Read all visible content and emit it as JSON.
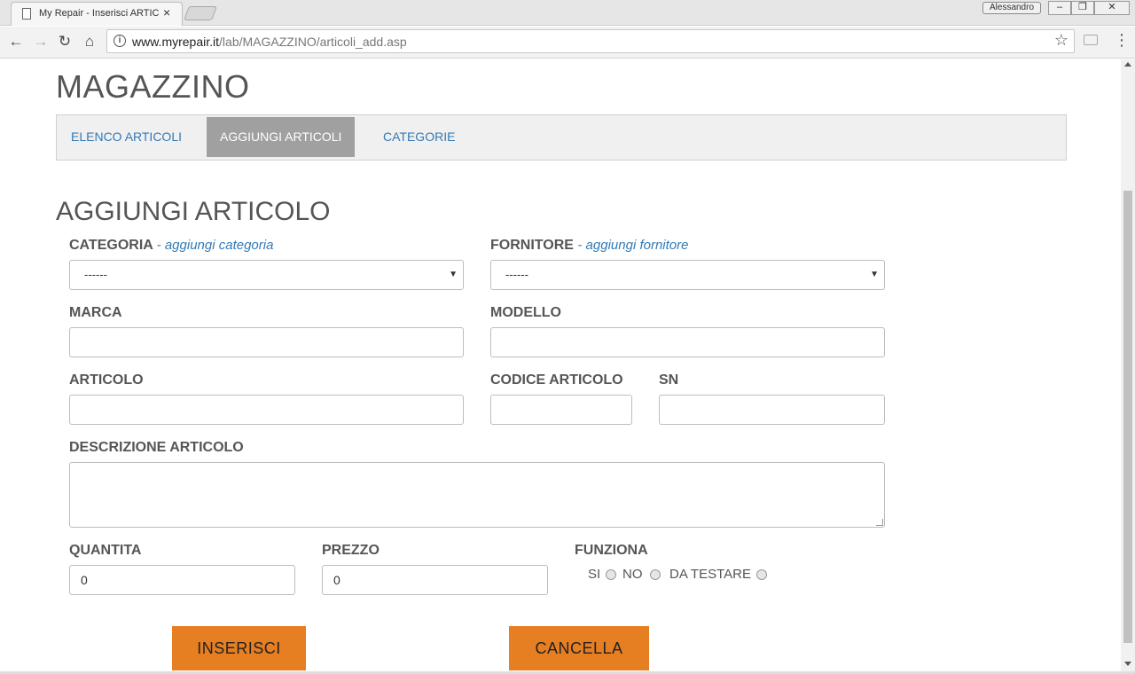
{
  "browser": {
    "tab_title": "My Repair - Inserisci ARTICOLO",
    "tab_close": "×",
    "profile_name": "Alessandro",
    "win_min": "–",
    "win_restore": "❐",
    "win_close": "✕",
    "url_host": "www.myrepair.it",
    "url_path": "/lab/MAGAZZINO/articoli_add.asp"
  },
  "page": {
    "title": "MAGAZZINO",
    "nav": [
      "ELENCO ARTICOLI",
      "AGGIUNGI ARTICOLI",
      "CATEGORIE"
    ],
    "active_nav": "AGGIUNGI ARTICOLI",
    "section_title": "AGGIUNGI ARTICOLO"
  },
  "form": {
    "categoria": {
      "label": "CATEGORIA",
      "link": "- aggiungi categoria",
      "value": "------"
    },
    "fornitore": {
      "label": "FORNITORE",
      "link": "- aggiungi fornitore",
      "value": "------"
    },
    "marca": {
      "label": "MARCA",
      "value": ""
    },
    "modello": {
      "label": "MODELLO",
      "value": ""
    },
    "articolo": {
      "label": "ARTICOLO",
      "value": ""
    },
    "codice_articolo": {
      "label": "CODICE ARTICOLO",
      "value": ""
    },
    "sn": {
      "label": "SN",
      "value": ""
    },
    "descrizione": {
      "label": "DESCRIZIONE ARTICOLO",
      "value": ""
    },
    "quantita": {
      "label": "QUANTITA",
      "value": "0"
    },
    "prezzo": {
      "label": "PREZZO",
      "value": "0"
    },
    "funziona": {
      "label": "FUNZIONA",
      "options": [
        "SI",
        "NO",
        "DA TESTARE"
      ]
    }
  },
  "buttons": {
    "submit": "INSERISCI",
    "cancel": "CANCELLA"
  },
  "colors": {
    "accent": "#e67e22",
    "link": "#337ab7",
    "active_nav": "#a0a0a0"
  },
  "icons": [
    "page-icon",
    "back-arrow-icon",
    "forward-arrow-icon",
    "reload-icon",
    "home-icon",
    "info-icon",
    "star-icon",
    "camera-icon",
    "menu-dots-icon"
  ]
}
